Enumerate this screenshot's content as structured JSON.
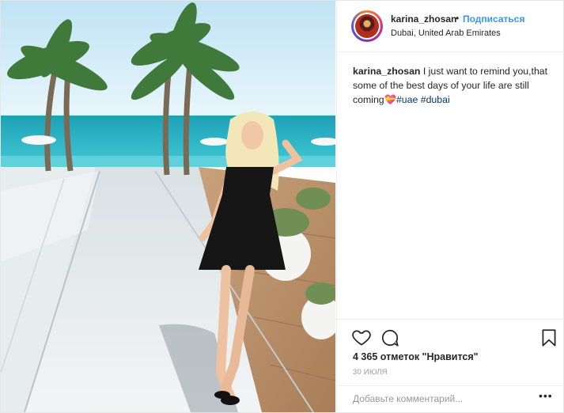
{
  "post": {
    "username": "karina_zhosan",
    "follow_label": "Подписаться",
    "separator": "•",
    "location": "Dubai, United Arab Emirates",
    "caption": {
      "username": "karina_zhosan",
      "text": " I just want to remind you,that some of the best days of your life are still coming",
      "emoji": "💝",
      "tags": [
        "#uae",
        "#dubai"
      ]
    },
    "likes_text": "4 365 отметок \"Нравится\"",
    "date": "30 ИЮЛЯ",
    "comment_placeholder": "Добавьте комментарий...",
    "more_label": "•••"
  },
  "icons": {
    "like": "heart-icon",
    "comment": "comment-icon",
    "save": "bookmark-icon",
    "more": "more-dots-icon"
  },
  "colors": {
    "link": "#3897f0",
    "hashtag": "#003569",
    "text": "#262626",
    "muted": "#999999",
    "border": "#efefef"
  }
}
